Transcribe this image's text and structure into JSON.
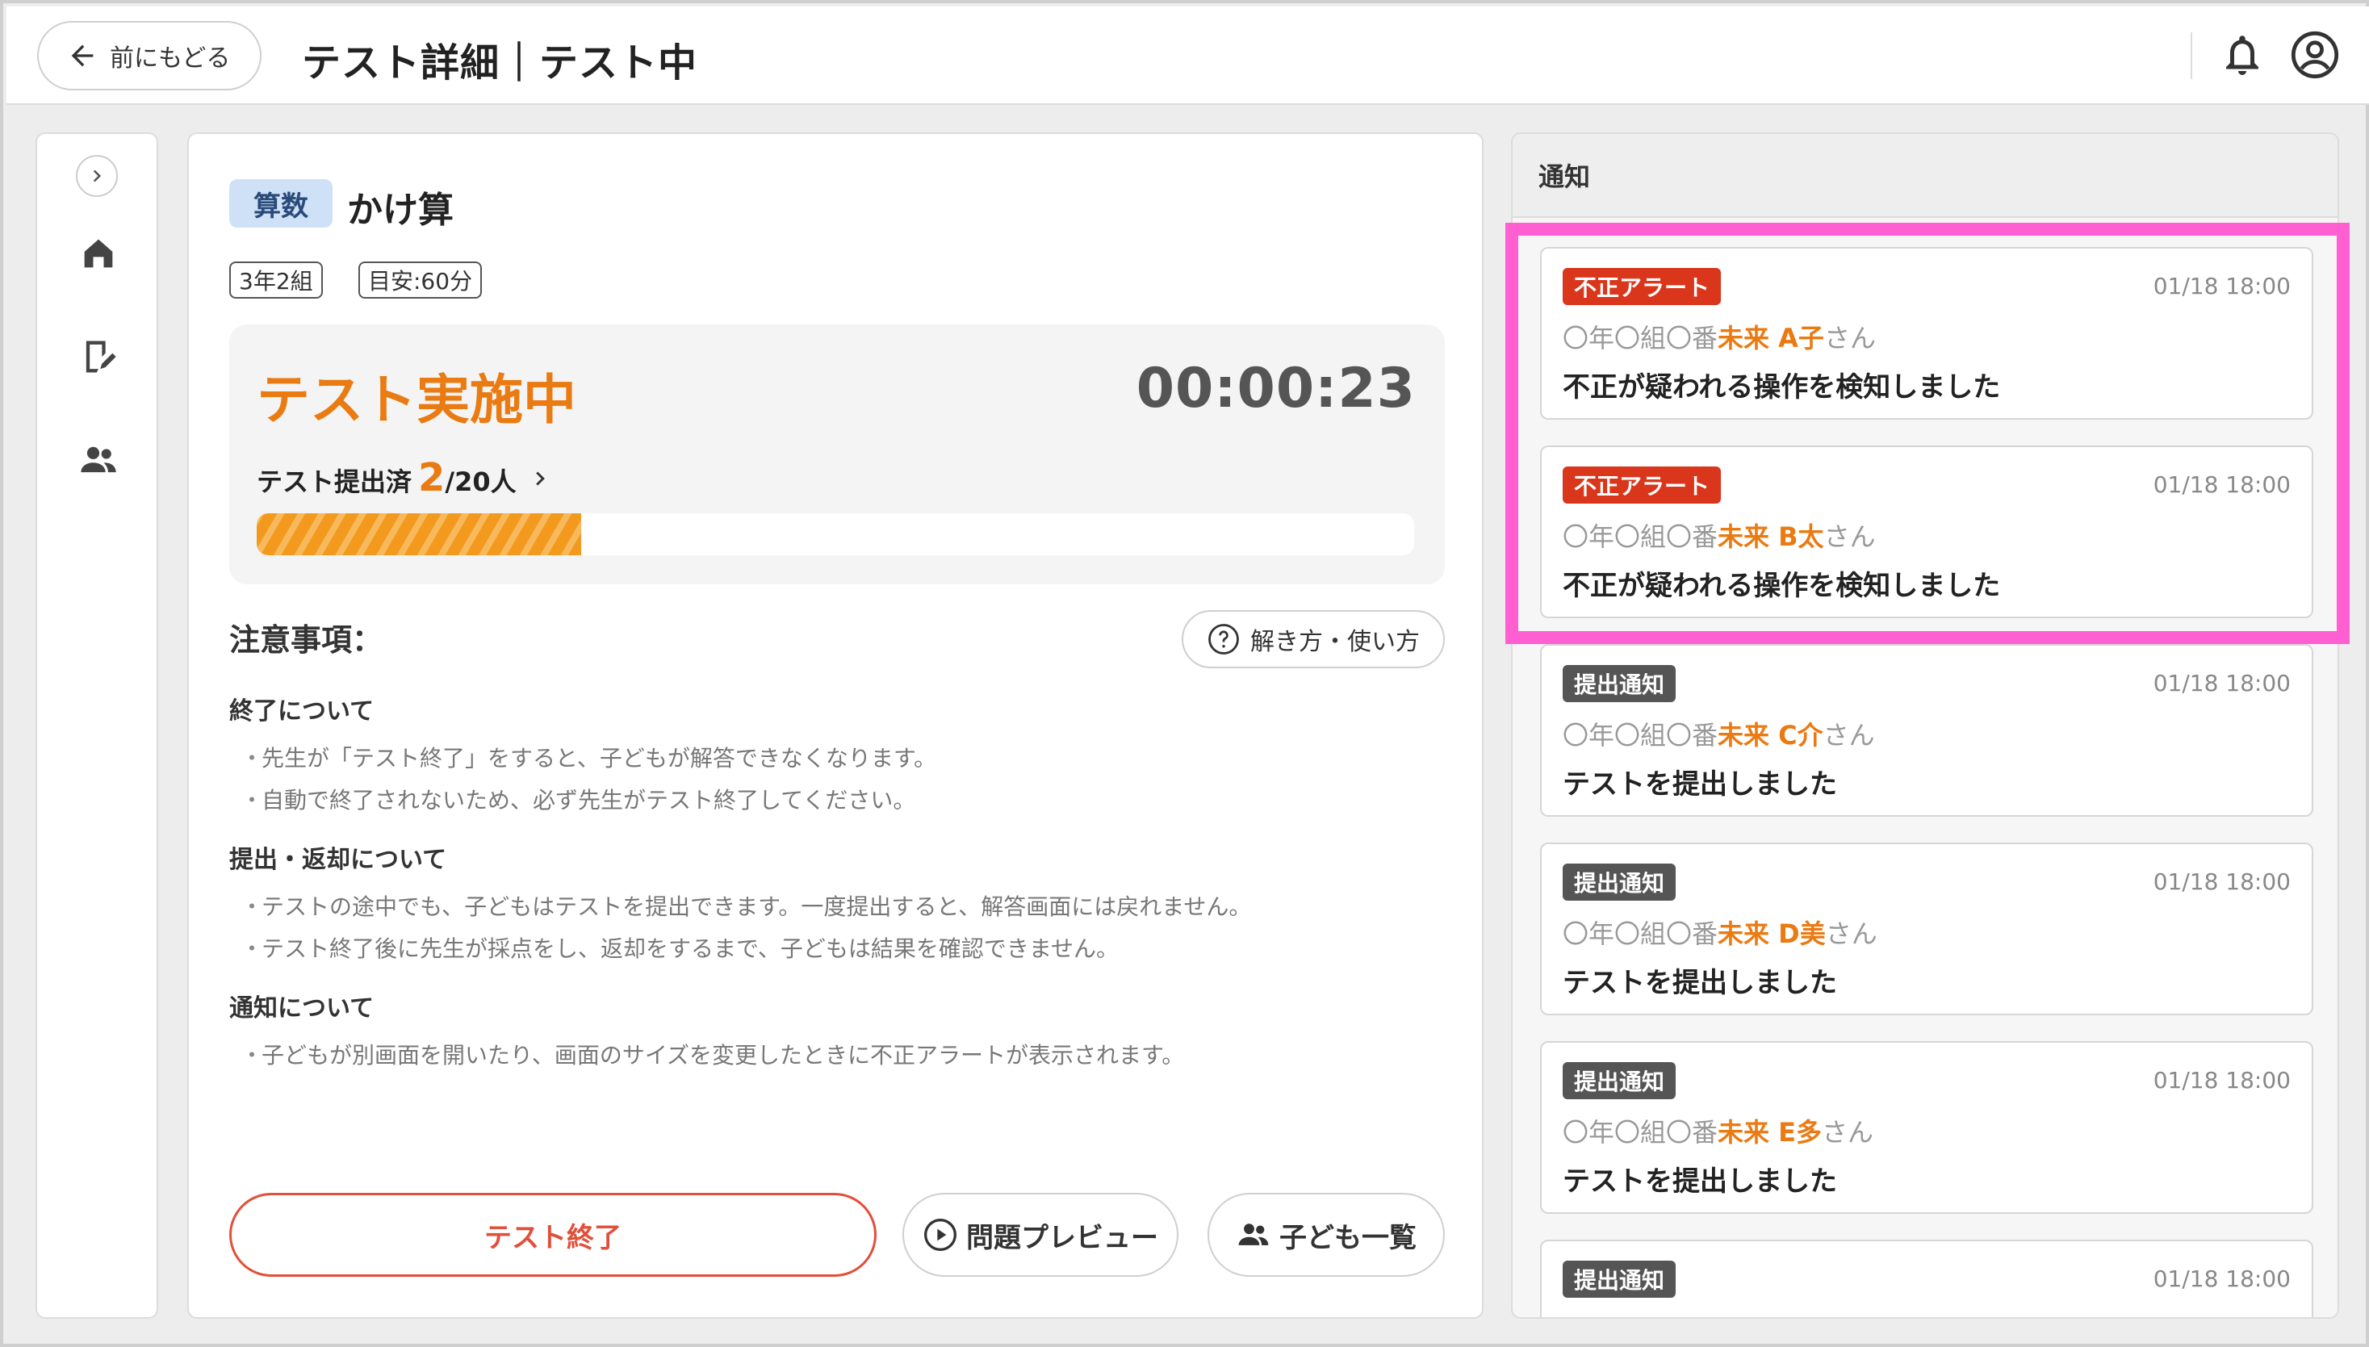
{
  "header": {
    "back_label": "前にもどる",
    "title": "テスト詳細｜テスト中"
  },
  "test": {
    "subject": "算数",
    "name": "かけ算",
    "class_tag": "3年2組",
    "duration_tag": "目安:60分",
    "status": "テスト実施中",
    "timer": "00:00:23",
    "submitted_label": "テスト提出済",
    "submitted_count": "2",
    "submitted_total": "/20人",
    "progress_fraction": 0.1
  },
  "notes": {
    "heading": "注意事項：",
    "howto_label": "解き方・使い方",
    "sections": [
      {
        "title": "終了について",
        "lines": [
          "先生が「テスト終了」をすると、子どもが解答できなくなります。",
          "自動で終了されないため、必ず先生がテスト終了してください。"
        ]
      },
      {
        "title": "提出・返却について",
        "lines": [
          "テストの途中でも、子どもはテストを提出できます。一度提出すると、解答画面には戻れません。",
          "テスト終了後に先生が採点をし、返却をするまで、子どもは結果を確認できません。"
        ]
      },
      {
        "title": "通知について",
        "lines": [
          "子どもが別画面を開いたり、画面のサイズを変更したときに不正アラートが表示されます。"
        ]
      }
    ],
    "bullet": "・"
  },
  "actions": {
    "end_label": "テスト終了",
    "preview_label": "問題プレビュー",
    "children_label": "子ども一覧"
  },
  "notifications": {
    "heading": "通知",
    "items": [
      {
        "badge": "不正アラート",
        "type": "alert",
        "time": "01/18 18:00",
        "prefix": "〇年〇組〇番",
        "name": "未来 A子",
        "suffix": "さん",
        "message": "不正が疑われる操作を検知しました"
      },
      {
        "badge": "不正アラート",
        "type": "alert",
        "time": "01/18 18:00",
        "prefix": "〇年〇組〇番",
        "name": "未来 B太",
        "suffix": "さん",
        "message": "不正が疑われる操作を検知しました"
      },
      {
        "badge": "提出通知",
        "type": "submit",
        "time": "01/18 18:00",
        "prefix": "〇年〇組〇番",
        "name": "未来 C介",
        "suffix": "さん",
        "message": "テストを提出しました"
      },
      {
        "badge": "提出通知",
        "type": "submit",
        "time": "01/18 18:00",
        "prefix": "〇年〇組〇番",
        "name": "未来 D美",
        "suffix": "さん",
        "message": "テストを提出しました"
      },
      {
        "badge": "提出通知",
        "type": "submit",
        "time": "01/18 18:00",
        "prefix": "〇年〇組〇番",
        "name": "未来 E多",
        "suffix": "さん",
        "message": "テストを提出しました"
      },
      {
        "badge": "提出通知",
        "type": "submit",
        "time": "01/18 18:00",
        "prefix": "",
        "name": "",
        "suffix": "",
        "message": ""
      }
    ]
  },
  "colors": {
    "accent": "#ea7a12",
    "alert": "#d9361b",
    "highlight": "#ff5fd0"
  }
}
